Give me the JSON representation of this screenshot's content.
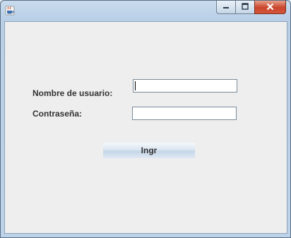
{
  "window": {
    "title": "",
    "controls": {
      "minimize_icon": "minimize-icon",
      "maximize_icon": "maximize-icon",
      "close_icon": "close-icon"
    }
  },
  "form": {
    "username_label": "Nombre de usuario:",
    "username_value": "",
    "password_label": "Contraseña:",
    "password_value": "",
    "submit_label": "Ingr"
  },
  "colors": {
    "panel_bg": "#eeeeee",
    "close_button": "#c9452b",
    "title_bar": "#bcd2e8"
  }
}
